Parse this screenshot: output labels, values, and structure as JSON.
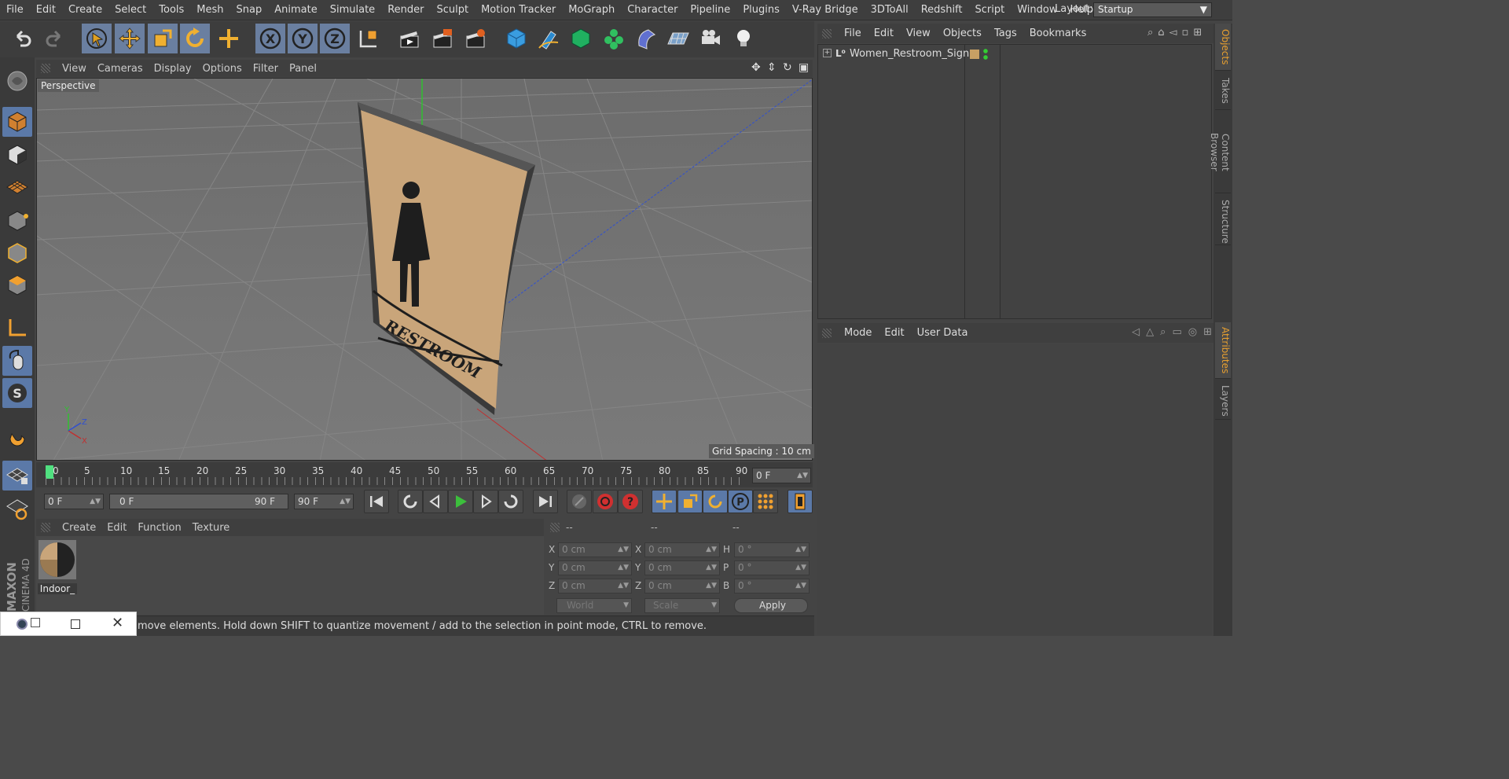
{
  "menubar": {
    "items": [
      "File",
      "Edit",
      "Create",
      "Select",
      "Tools",
      "Mesh",
      "Snap",
      "Animate",
      "Simulate",
      "Render",
      "Sculpt",
      "Motion Tracker",
      "MoGraph",
      "Character",
      "Pipeline",
      "Plugins",
      "V-Ray Bridge",
      "3DToAll",
      "Redshift",
      "Script",
      "Window",
      "Help"
    ],
    "layout_label": "Layout:",
    "layout_value": "Startup"
  },
  "viewport": {
    "menu": [
      "View",
      "Cameras",
      "Display",
      "Options",
      "Filter",
      "Panel"
    ],
    "label": "Perspective",
    "grid_spacing": "Grid Spacing : 10 cm",
    "sign_text": "RESTROOM"
  },
  "timeline": {
    "ticks": [
      "0",
      "5",
      "10",
      "15",
      "20",
      "25",
      "30",
      "35",
      "40",
      "45",
      "50",
      "55",
      "60",
      "65",
      "70",
      "75",
      "80",
      "85",
      "90"
    ],
    "current_frame": "0 F",
    "start_field": "0 F",
    "range_start": "0 F",
    "range_end": "90 F",
    "end_field": "90 F"
  },
  "materials": {
    "menu": [
      "Create",
      "Edit",
      "Function",
      "Texture"
    ],
    "items": [
      {
        "name": "Indoor_"
      }
    ]
  },
  "coords": {
    "headers": [
      "--",
      "--",
      "--"
    ],
    "rows": [
      {
        "a": "X",
        "av": "0 cm",
        "b": "X",
        "bv": "0 cm",
        "c": "H",
        "cv": "0 °"
      },
      {
        "a": "Y",
        "av": "0 cm",
        "b": "Y",
        "bv": "0 cm",
        "c": "P",
        "cv": "0 °"
      },
      {
        "a": "Z",
        "av": "0 cm",
        "b": "Z",
        "bv": "0 cm",
        "c": "B",
        "cv": "0 °"
      }
    ],
    "mode1": "World",
    "mode2": "Scale",
    "apply": "Apply"
  },
  "objects": {
    "menu": [
      "File",
      "Edit",
      "View",
      "Objects",
      "Tags",
      "Bookmarks"
    ],
    "items": [
      {
        "name": "Women_Restroom_Sign",
        "tag_color": "#c8a064"
      }
    ]
  },
  "attributes": {
    "menu": [
      "Mode",
      "Edit",
      "User Data"
    ]
  },
  "right_tabs": {
    "top": [
      "Objects",
      "Takes",
      "Content Browser",
      "Structure"
    ],
    "bottom": [
      "Attributes",
      "Layers"
    ]
  },
  "status": {
    "text": "move elements. Hold down SHIFT to quantize movement / add to the selection in point mode, CTRL to remove."
  },
  "brand": {
    "line1": "MAXON",
    "line2": "CINEMA 4D"
  },
  "colors": {
    "accent": "#5b79a8",
    "axis_x": "#c03030",
    "axis_y": "#30c030",
    "axis_z": "#3050d0",
    "play": "#3cbf3c",
    "record": "#d03030"
  }
}
